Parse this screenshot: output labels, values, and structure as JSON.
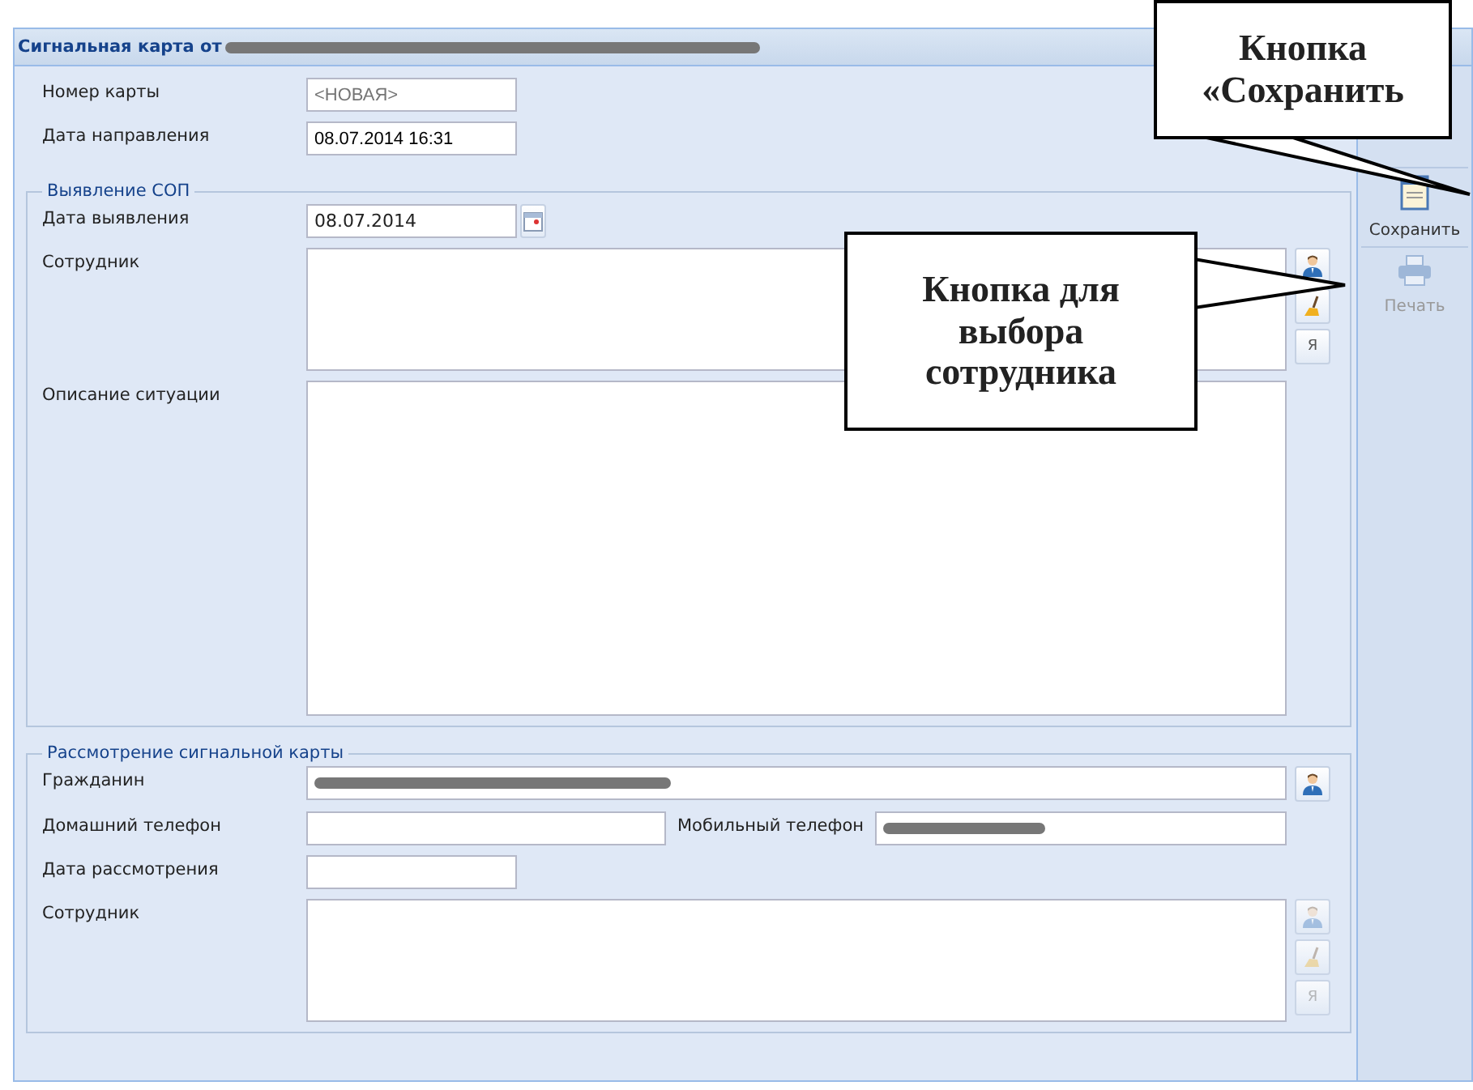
{
  "window": {
    "title": "Сигнальная карта от",
    "title_redacted": true
  },
  "header_fields": [
    {
      "label": "Номер карты",
      "placeholder": "<НОВАЯ>"
    },
    {
      "label": "Дата направления",
      "value": "08.07.2014 16:31"
    }
  ],
  "sections": [
    {
      "legend": "Выявление СОП",
      "rows": [
        {
          "kind": "date",
          "label": "Дата выявления",
          "value": "08.07.2014"
        },
        {
          "kind": "picker",
          "label": "Сотрудник",
          "disabled": false,
          "self_label": "Я"
        },
        {
          "kind": "memo",
          "label": "Описание ситуации"
        }
      ]
    },
    {
      "legend": "Рассмотрение сигнальной карты",
      "rows": [
        {
          "kind": "person",
          "label": "Гражданин",
          "redacted": true
        },
        {
          "kind": "pair",
          "label": "Домашний телефон",
          "label_2": "Мобильный телефон",
          "redacted_2": true
        },
        {
          "kind": "short",
          "label": "Дата рассмотрения"
        },
        {
          "kind": "picker",
          "label": "Сотрудник",
          "disabled": true,
          "self_label": "Я"
        }
      ]
    }
  ],
  "toolbar": [
    {
      "kind": "save",
      "label": "Сохранить",
      "disabled": false
    },
    {
      "kind": "print",
      "label": "Печать",
      "disabled": true
    }
  ],
  "callouts": [
    {
      "text": "Кнопка «Сохранить"
    },
    {
      "text": "Кнопка для выбора сотрудника"
    }
  ]
}
